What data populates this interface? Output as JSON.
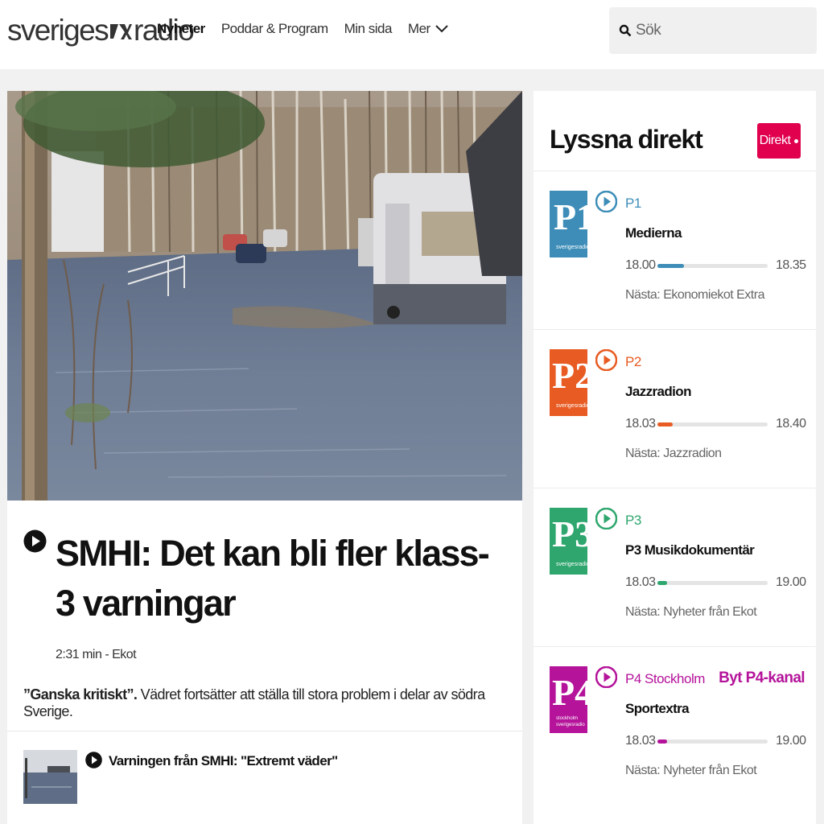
{
  "header": {
    "logo": "sverigesradio",
    "nav": [
      "Nyheter",
      "Poddar & Program",
      "Min sida",
      "Mer"
    ],
    "search_placeholder": "Sök"
  },
  "article": {
    "headline": "SMHI: Det kan bli fler klass-3 varningar",
    "meta": "2:31 min - Ekot",
    "lead_bold": "”Ganska kritiskt”.",
    "lead_text": " Vädret fortsätter att ställa till stora problem i delar av södra Sverige.",
    "related_title": "Varningen från SMHI: \"Extremt väder\""
  },
  "sidebar": {
    "title": "Lyssna direkt",
    "direkt_label": "Direkt",
    "channels": [
      {
        "name": "P1",
        "program": "Medierna",
        "start": "18.00",
        "end": "18.35",
        "progress": 0.24,
        "next": "Nästa: Ekonomiekot Extra",
        "color": "#3d8db8",
        "switch": ""
      },
      {
        "name": "P2",
        "program": "Jazzradion",
        "start": "18.03",
        "end": "18.40",
        "progress": 0.14,
        "next": "Nästa: Jazzradion",
        "color": "#e85b22",
        "switch": ""
      },
      {
        "name": "P3",
        "program": "P3 Musikdokumentär",
        "start": "18.03",
        "end": "19.00",
        "progress": 0.09,
        "next": "Nästa: Nyheter från Ekot",
        "color": "#2ea66e",
        "switch": ""
      },
      {
        "name": "P4 Stockholm",
        "program": "Sportextra",
        "start": "18.03",
        "end": "19.00",
        "progress": 0.09,
        "next": "Nästa: Nyheter från Ekot",
        "color": "#b4139a",
        "switch": "Byt P4-kanal"
      }
    ]
  }
}
